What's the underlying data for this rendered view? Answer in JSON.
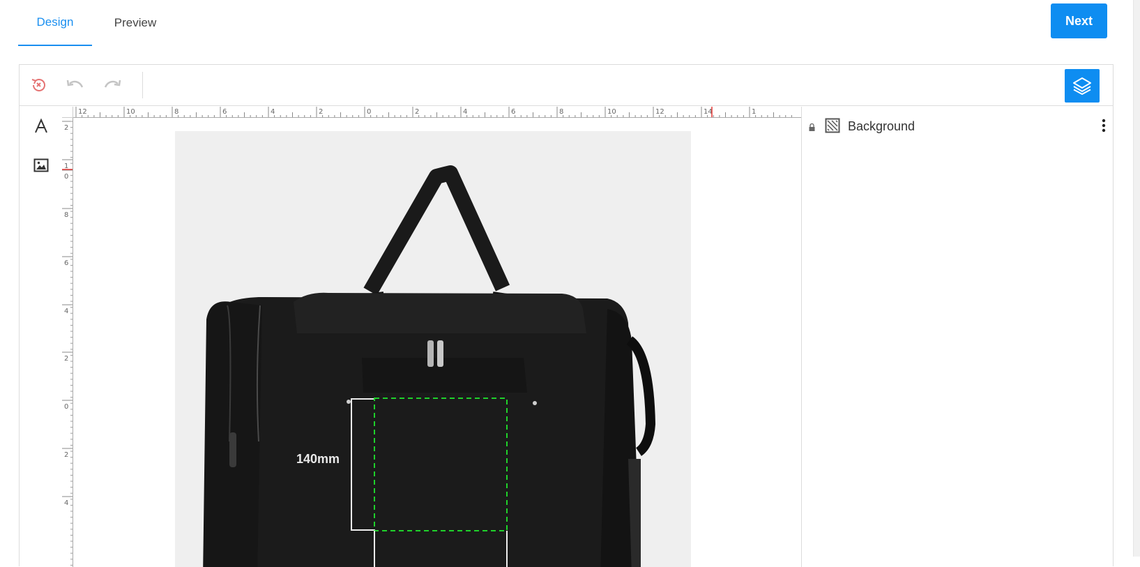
{
  "tabs": [
    {
      "label": "Design",
      "active": true
    },
    {
      "label": "Preview",
      "active": false
    }
  ],
  "next_label": "Next",
  "toolbar": {
    "reset_icon": "reset-icon",
    "undo_icon": "undo-icon",
    "redo_icon": "redo-icon",
    "layers_icon": "layers-icon"
  },
  "side_tools": [
    {
      "name": "text-tool",
      "icon": "text-icon"
    },
    {
      "name": "image-tool",
      "icon": "image-icon"
    }
  ],
  "ruler_h_labels": [
    "12",
    "10",
    "8",
    "6",
    "4",
    "2",
    "0",
    "2",
    "4",
    "6",
    "8",
    "10",
    "12",
    "14",
    "1"
  ],
  "ruler_v_labels": [
    "2",
    "1",
    "0",
    "8",
    "6",
    "4",
    "2",
    "0",
    "2",
    "4"
  ],
  "dimension_label": "140mm",
  "layers": [
    {
      "name": "Background",
      "locked": true
    }
  ],
  "colors": {
    "accent": "#0e8df1",
    "print_area": "#1fd12b",
    "reset": "#e57373"
  }
}
